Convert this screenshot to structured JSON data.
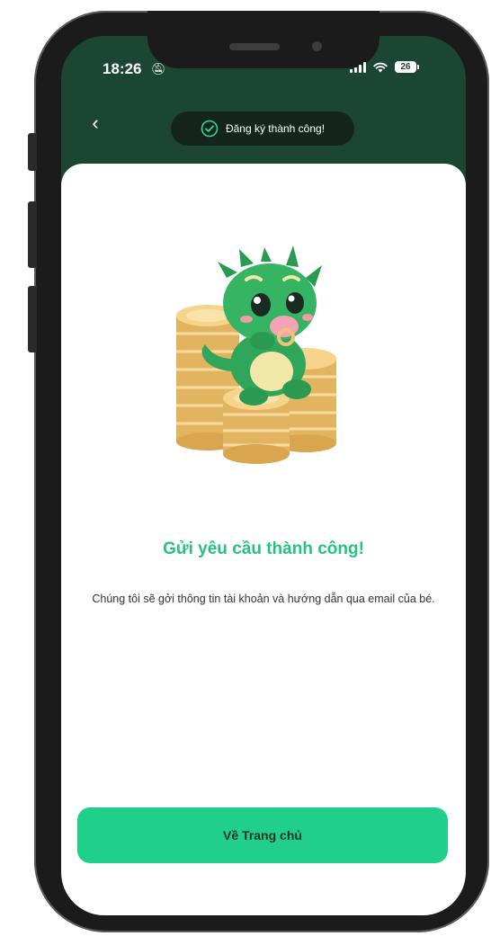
{
  "status_bar": {
    "time": "18:26",
    "battery": "26"
  },
  "header": {
    "toast_text": "Đăng ký thành công!"
  },
  "content": {
    "title": "Gửi yêu cầu thành công!",
    "description": "Chúng tôi sẽ gởi thông tin tài khoản và hướng dẫn qua email của bé.",
    "home_button_label": "Về Trang chủ"
  },
  "icons": {
    "back": "back-chevron-icon",
    "toast": "check-circle-icon",
    "mascot": "dragon-mascot-on-coins",
    "status": [
      "silent-bell-icon",
      "signal-icon",
      "wifi-icon",
      "battery-icon"
    ]
  },
  "colors": {
    "header_bg": "#1c4634",
    "accent_green": "#27c27f",
    "button_bg": "#20d08a",
    "toast_bg": "#15241c"
  }
}
